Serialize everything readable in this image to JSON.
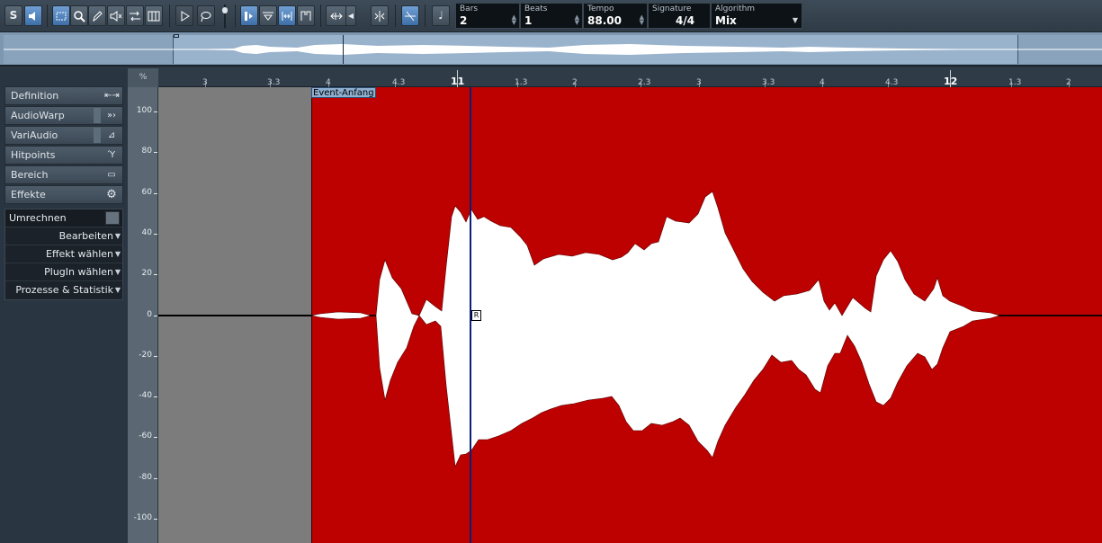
{
  "toolbar": {
    "tools": [
      "solo-button",
      "listen-button",
      "range-tool",
      "zoom-tool",
      "draw-tool",
      "mute-tool",
      "warp-tool",
      "scrub-tool",
      "play-button",
      "loop-button",
      "snap-button",
      "audition-button",
      "hitpoint-button",
      "marker-button",
      "cycle-button",
      "transpose-button",
      "musical-mode-button",
      "note-button"
    ],
    "solo_glyph": "S",
    "info": {
      "bars_label": "Bars",
      "bars_value": "2",
      "beats_label": "Beats",
      "beats_value": "1",
      "tempo_label": "Tempo",
      "tempo_value": "88.00",
      "signature_label": "Signature",
      "signature_value": "4/4",
      "algorithm_label": "Algorithm",
      "algorithm_value": "Mix"
    }
  },
  "sidebar": {
    "tabs": [
      {
        "label": "Definition",
        "icon": "width-icon"
      },
      {
        "label": "AudioWarp",
        "icon": "warp-icon"
      },
      {
        "label": "VariAudio",
        "icon": "variaudio-icon"
      },
      {
        "label": "Hitpoints",
        "icon": "hitpoint-icon"
      },
      {
        "label": "Bereich",
        "icon": "range-icon"
      },
      {
        "label": "Effekte",
        "icon": "gear-icon"
      }
    ],
    "process": {
      "header": "Umrechnen",
      "items": [
        "Bearbeiten",
        "Effekt wählen",
        "PlugIn wählen",
        "Prozesse & Statistik"
      ]
    }
  },
  "ruler": {
    "corner": "%",
    "labels": [
      "3",
      "3.3",
      "4",
      "4.3",
      "11",
      "1.3",
      "2",
      "2.3",
      "3",
      "3.3",
      "4",
      "4.3",
      "12",
      "1.3",
      "2"
    ]
  },
  "scale": {
    "labels": [
      "100",
      "80",
      "60",
      "40",
      "20",
      "0",
      "-20",
      "-40",
      "-60",
      "-80",
      "-100"
    ]
  },
  "editor": {
    "event_start_label": "Event-Anfang",
    "marker_label": "R",
    "event_color": "#bd0000",
    "waveform_color": "#ffffff",
    "cursor_color": "#0b1e7a"
  }
}
